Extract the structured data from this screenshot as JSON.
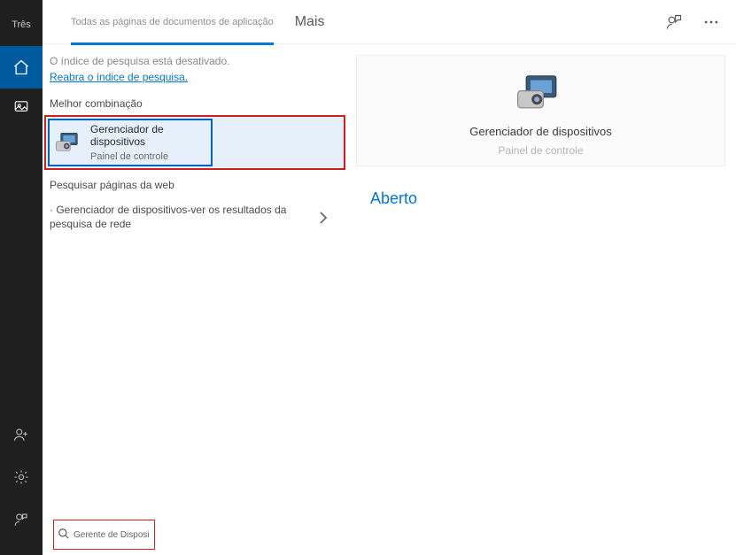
{
  "rail": {
    "top_label": "Três"
  },
  "tabs": {
    "active": "Todas as páginas de documentos de aplicação",
    "more": "Mais"
  },
  "info_bar": {
    "disabled_msg": "O índice de pesquisa está desativado.",
    "reenable": "Reabra o índice de pesquisa."
  },
  "sections": {
    "best_match": "Melhor combinação",
    "web_search": "Pesquisar páginas da web"
  },
  "best_match": {
    "title": "Gerenciador de dispositivos",
    "subtitle": "Painel de controle"
  },
  "web_search": {
    "item1": "· Gerenciador de dispositivos-ver os resultados da pesquisa de rede"
  },
  "preview": {
    "title": "Gerenciador de dispositivos",
    "subtitle": "Painel de controle",
    "open_label": "Aberto"
  },
  "search": {
    "value": "Gerente de Dispositivo P"
  }
}
